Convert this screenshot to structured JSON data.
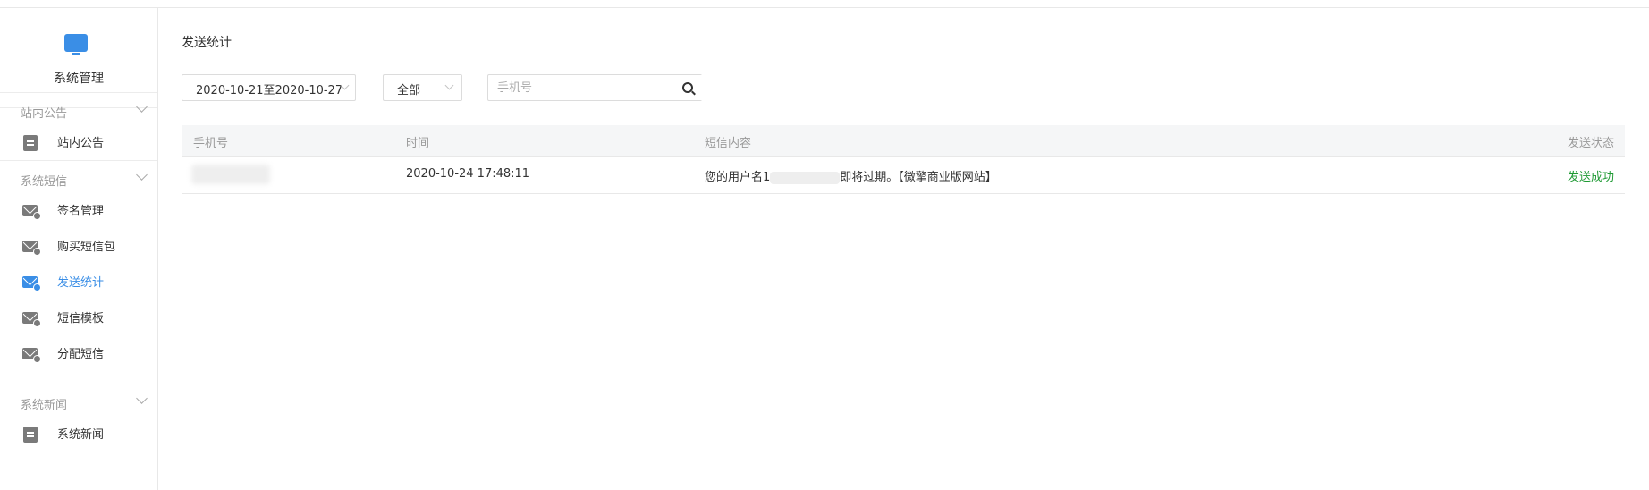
{
  "sidebar": {
    "brand": {
      "label": "系统管理",
      "icon": "monitor-icon"
    },
    "groups": [
      {
        "label": "站内公告",
        "items": [
          {
            "label": "站内公告",
            "icon": "document-icon"
          }
        ]
      },
      {
        "label": "系统短信",
        "items": [
          {
            "label": "签名管理",
            "icon": "mail-icon"
          },
          {
            "label": "购买短信包",
            "icon": "mail-icon"
          },
          {
            "label": "发送统计",
            "icon": "mail-icon",
            "active": true
          },
          {
            "label": "短信模板",
            "icon": "mail-icon"
          },
          {
            "label": "分配短信",
            "icon": "mail-icon"
          }
        ]
      },
      {
        "label": "系统新闻",
        "items": [
          {
            "label": "系统新闻",
            "icon": "document-icon"
          }
        ]
      }
    ]
  },
  "main": {
    "title": "发送统计",
    "filters": {
      "date_range": "2020-10-21至2020-10-27",
      "status": "全部",
      "search_placeholder": "手机号"
    },
    "table": {
      "columns": [
        "手机号",
        "时间",
        "短信内容",
        "发送状态"
      ],
      "rows": [
        {
          "phone": "",
          "time": "2020-10-24 17:48:11",
          "content_prefix": "您的用户名1",
          "content_suffix": "即将过期。【微擎商业版网站】",
          "status": "发送成功"
        }
      ]
    }
  },
  "colors": {
    "accent": "#3a8ee6",
    "success": "#1f9a34",
    "muted": "#999999"
  }
}
